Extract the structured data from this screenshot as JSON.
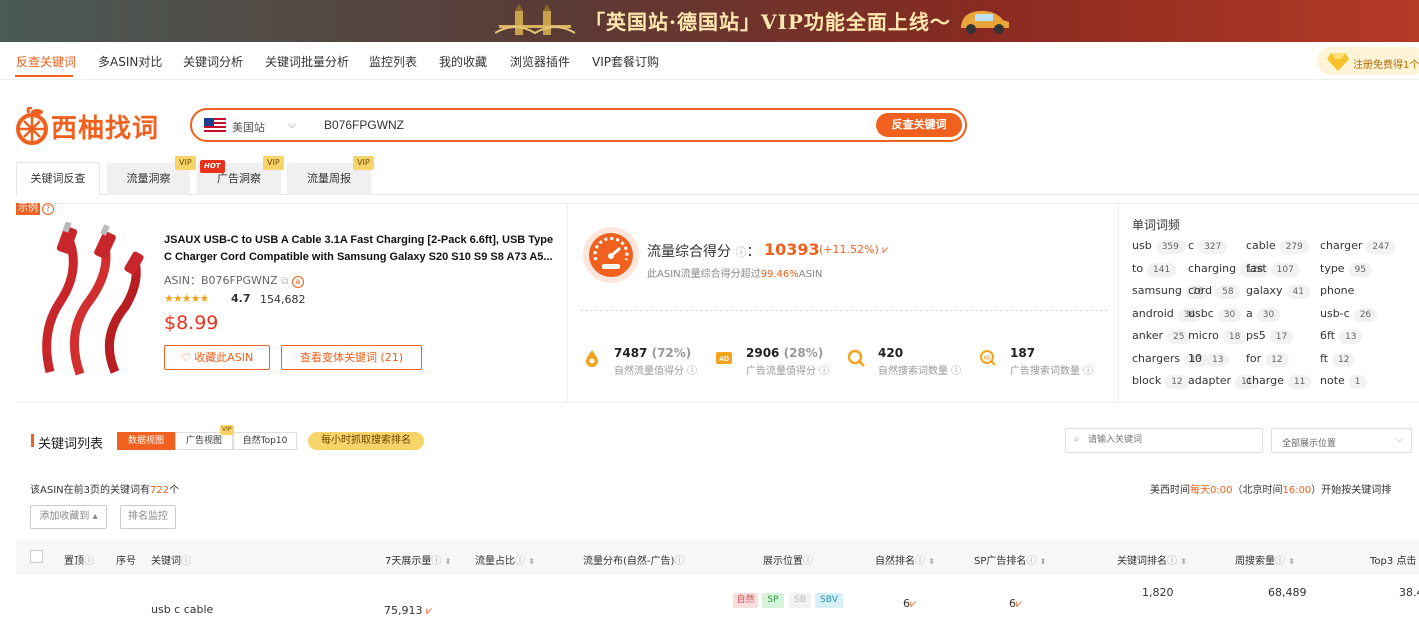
{
  "banner": {
    "text": "「英国站·德国站」VIP功能全面上线～"
  },
  "nav": {
    "items": [
      "反查关键词",
      "多ASIN对比",
      "关键词分析",
      "关键词批量分析",
      "监控列表",
      "我的收藏",
      "浏览器插件",
      "VIP套餐订购"
    ],
    "promo": "注册免费得1个"
  },
  "logo": {
    "text": "西柚找词"
  },
  "search": {
    "site": "美国站",
    "query": "B076FPGWNZ",
    "button": "反查关键词"
  },
  "tabs": {
    "items": [
      "关键词反查",
      "流量洞察",
      "广告洞察",
      "流量周报"
    ],
    "vip": "VIP",
    "hot": "HOT"
  },
  "example": {
    "label": "示例",
    "help": "?"
  },
  "product": {
    "title": "JSAUX USB-C to USB A Cable 3.1A Fast Charging [2-Pack 6.6ft], USB Type C Charger Cord Compatible with Samsung Galaxy S20 S10 S9 S8 A73 A5...",
    "asin_label": "ASIN：",
    "asin": "B076FPGWNZ",
    "rating": "4.7",
    "rating_value": 4.7,
    "reviews": "154,682",
    "price": "$8.99",
    "fav_button": "收藏此ASIN",
    "variant_button": "查看变体关键词 (21)"
  },
  "score": {
    "label": "流量综合得分",
    "value": "10393",
    "change": "(+11.52%)",
    "sub_prefix": "此ASIN流量综合得分超过",
    "sub_pct": "99.46%",
    "sub_suffix": "ASIN"
  },
  "metrics": [
    {
      "value": "7487",
      "pct": "(72%)",
      "label": "自然流量值得分"
    },
    {
      "value": "2906",
      "pct": "(28%)",
      "label": "广告流量值得分"
    },
    {
      "value": "420",
      "pct": "",
      "label": "自然搜索词数量"
    },
    {
      "value": "187",
      "pct": "",
      "label": "广告搜索词数量"
    }
  ],
  "word_freq": {
    "title": "单词词频",
    "items": [
      {
        "w": "usb",
        "c": "359"
      },
      {
        "w": "c",
        "c": "327"
      },
      {
        "w": "cable",
        "c": "279"
      },
      {
        "w": "charger",
        "c": "247"
      },
      {
        "w": "to",
        "c": "141"
      },
      {
        "w": "charging",
        "c": "128"
      },
      {
        "w": "fast",
        "c": "107"
      },
      {
        "w": "type",
        "c": "95"
      },
      {
        "w": "samsung",
        "c": "76"
      },
      {
        "w": "cord",
        "c": "58"
      },
      {
        "w": "galaxy",
        "c": "41"
      },
      {
        "w": "phone",
        "c": ""
      },
      {
        "w": "android",
        "c": "36"
      },
      {
        "w": "usbc",
        "c": "30"
      },
      {
        "w": "a",
        "c": "30"
      },
      {
        "w": "usb-c",
        "c": "26"
      },
      {
        "w": "anker",
        "c": "25"
      },
      {
        "w": "micro",
        "c": "18"
      },
      {
        "w": "ps5",
        "c": "17"
      },
      {
        "w": "6ft",
        "c": "13"
      },
      {
        "w": "chargers",
        "c": "13"
      },
      {
        "w": "10",
        "c": "13"
      },
      {
        "w": "for",
        "c": "12"
      },
      {
        "w": "ft",
        "c": "12"
      },
      {
        "w": "block",
        "c": "12"
      },
      {
        "w": "adapter",
        "c": "11"
      },
      {
        "w": "charge",
        "c": "11"
      },
      {
        "w": "note",
        "c": "1"
      }
    ]
  },
  "kw_section": {
    "title": "关键词列表",
    "views": [
      "数据视图",
      "广告视图",
      "自然Top10"
    ],
    "vip": "VIP",
    "hourly": "每小时抓取搜索排名",
    "search_placeholder": "请输入关键词",
    "position_select": "全部展示位置",
    "count_prefix": "该ASIN在前3页的关键词有",
    "count": "722",
    "count_suffix": "个",
    "time_a": "美西时间",
    "time_b": "每天0:00",
    "time_c": "（北京时间",
    "time_d": "16:00",
    "time_e": "）开始按关键词排",
    "add_fav": "添加收藏到",
    "rank_monitor": "排名监控"
  },
  "table": {
    "headers": [
      "置顶",
      "序号",
      "关键词",
      "7天展示量",
      "流量占比",
      "流量分布(自然-广告)",
      "展示位置",
      "自然排名",
      "SP广告排名",
      "关键词排名",
      "周搜索量",
      "Top3 点击"
    ],
    "row1": {
      "keyword": "usb c cable",
      "impressions": "75,913",
      "tags": [
        "自然",
        "SP",
        "SB",
        "SBV"
      ],
      "natural_rank": "6",
      "sp_rank": "6",
      "kw_rank": "1,820",
      "weekly_search": "68,489",
      "top3": "38.4"
    }
  },
  "colors": {
    "accent": "#f0601e",
    "vip": "#f7d46a"
  }
}
